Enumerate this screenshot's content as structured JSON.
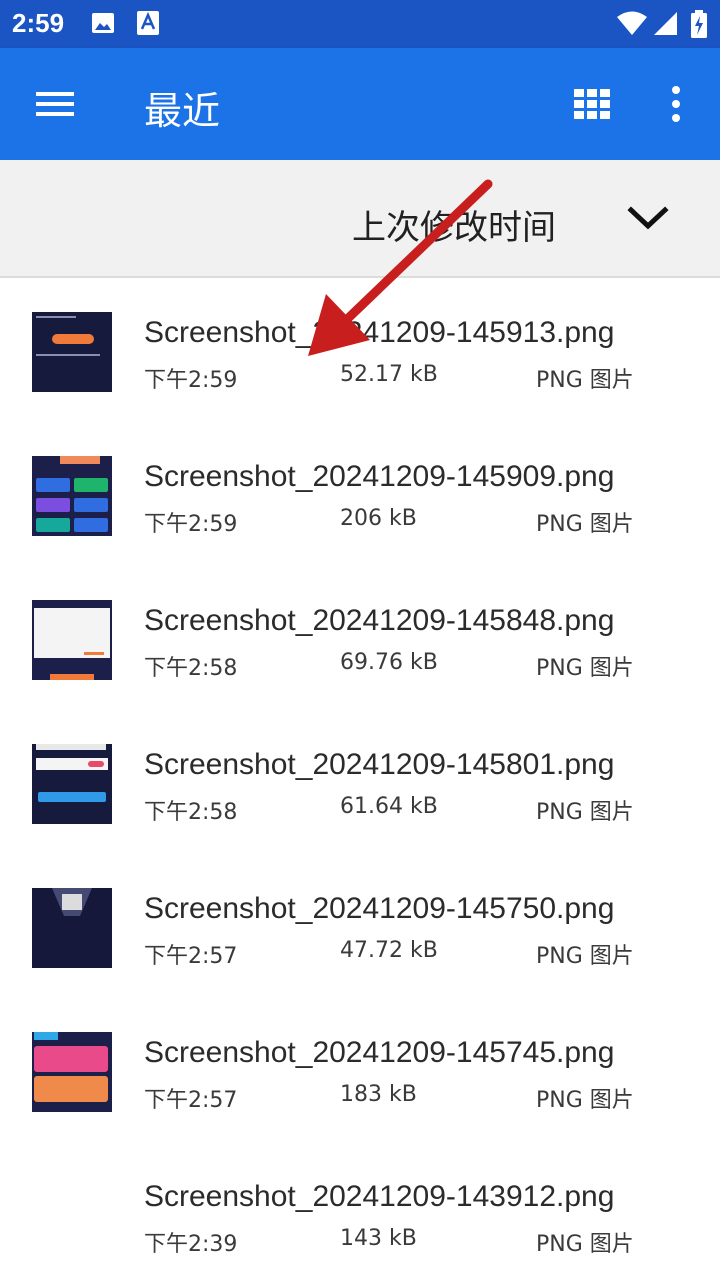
{
  "status_bar": {
    "time": "2:59",
    "icons": [
      "image-icon",
      "text-a-icon",
      "wifi-icon",
      "signal-icon",
      "battery-charging-icon"
    ]
  },
  "app_bar": {
    "title": "最近",
    "icons": [
      "menu-icon",
      "grid-view-icon",
      "more-vert-icon"
    ]
  },
  "sort_bar": {
    "label": "上次修改时间",
    "icon": "chevron-down-icon"
  },
  "files": [
    {
      "name": "Screenshot_20241209-145913.png",
      "time": "下午2:59",
      "size": "52.17 kB",
      "type": "PNG 图片"
    },
    {
      "name": "Screenshot_20241209-145909.png",
      "time": "下午2:59",
      "size": "206 kB",
      "type": "PNG 图片"
    },
    {
      "name": "Screenshot_20241209-145848.png",
      "time": "下午2:58",
      "size": "69.76 kB",
      "type": "PNG 图片"
    },
    {
      "name": "Screenshot_20241209-145801.png",
      "time": "下午2:58",
      "size": "61.64 kB",
      "type": "PNG 图片"
    },
    {
      "name": "Screenshot_20241209-145750.png",
      "time": "下午2:57",
      "size": "47.72 kB",
      "type": "PNG 图片"
    },
    {
      "name": "Screenshot_20241209-145745.png",
      "time": "下午2:57",
      "size": "183 kB",
      "type": "PNG 图片"
    },
    {
      "name": "Screenshot_20241209-143912.png",
      "time": "下午2:39",
      "size": "143 kB",
      "type": "PNG 图片"
    }
  ],
  "colors": {
    "status_bar": "#1b55c4",
    "app_bar": "#1c73e8",
    "sort_bar": "#f1f1f1",
    "annotation_arrow": "#c81e1e"
  }
}
